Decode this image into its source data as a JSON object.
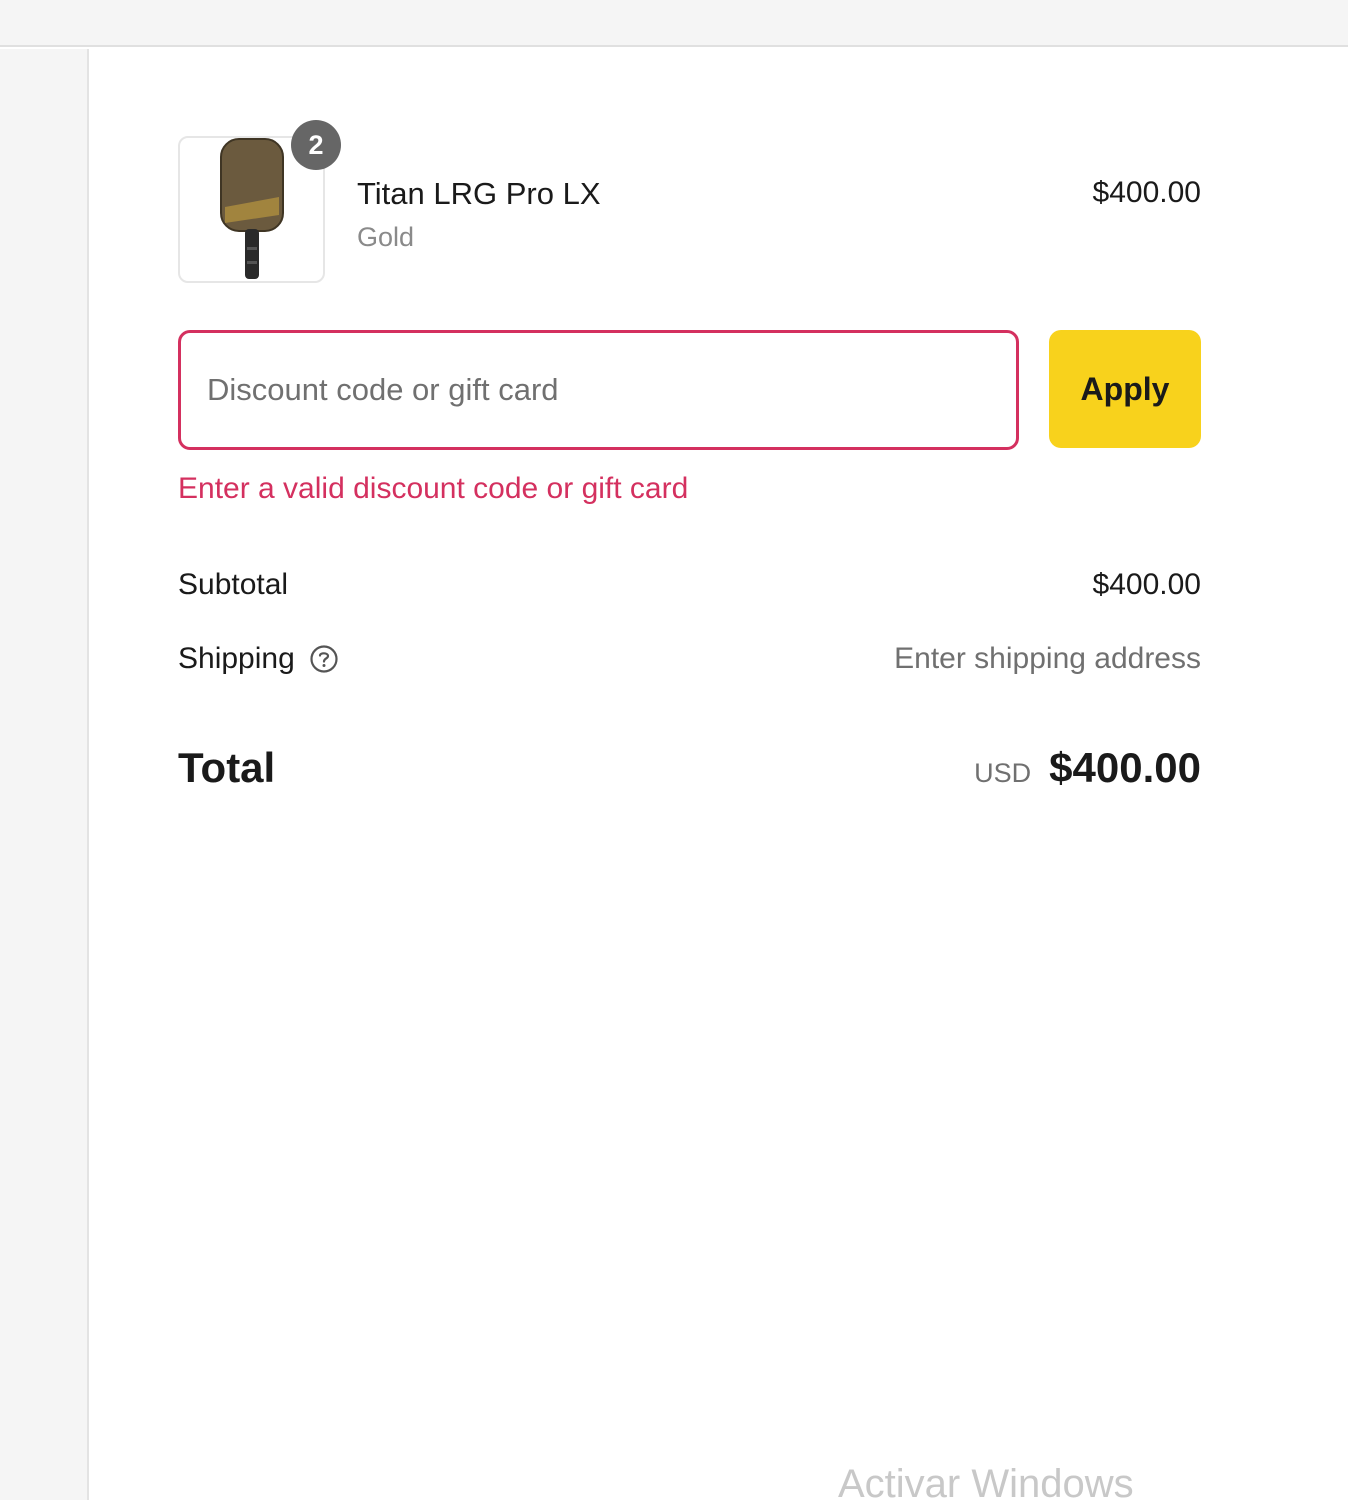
{
  "product": {
    "quantity": "2",
    "name": "Titan LRG Pro LX",
    "variant": "Gold",
    "price": "$400.00"
  },
  "discount": {
    "placeholder": "Discount code or gift card",
    "apply_label": "Apply",
    "error": "Enter a valid discount code or gift card"
  },
  "totals": {
    "subtotal_label": "Subtotal",
    "subtotal_value": "$400.00",
    "shipping_label": "Shipping",
    "shipping_value": "Enter shipping address",
    "total_label": "Total",
    "currency": "USD",
    "total_value": "$400.00"
  },
  "watermark": "Activar Windows",
  "colors": {
    "accent_error": "#d4305f",
    "apply_button": "#f8d21c",
    "badge": "#666666"
  },
  "icons": {
    "help": "question-circle-icon",
    "product": "pickleball-paddle-icon"
  }
}
